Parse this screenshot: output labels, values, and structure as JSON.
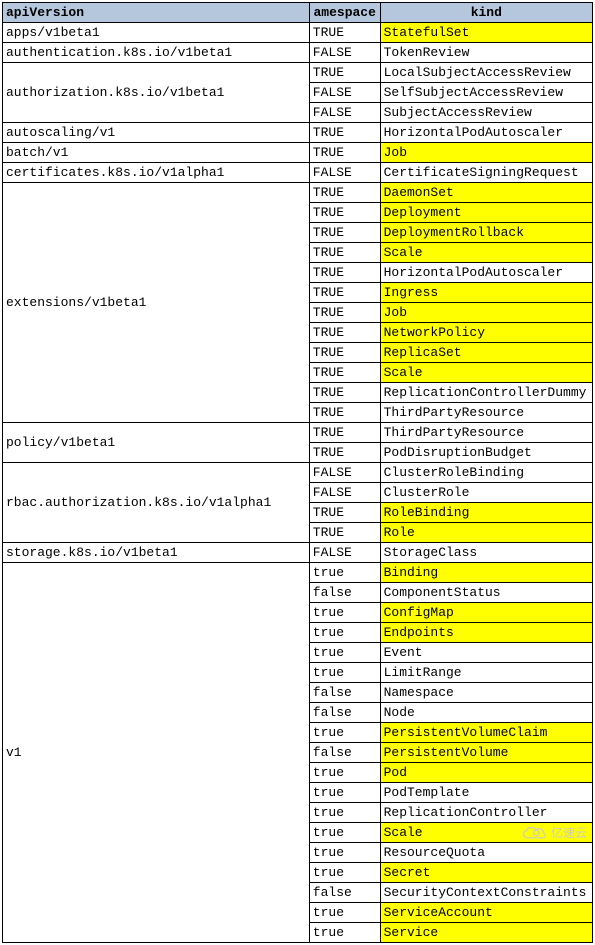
{
  "headers": {
    "c1": "apiVersion",
    "c2": "amespace",
    "c3": "kind"
  },
  "groups": [
    {
      "api": "apps/v1beta1",
      "rows": [
        {
          "ns": "TRUE",
          "kind": "StatefulSet",
          "hl": true
        }
      ]
    },
    {
      "api": "authentication.k8s.io/v1beta1",
      "rows": [
        {
          "ns": "FALSE",
          "kind": "TokenReview",
          "hl": false
        }
      ]
    },
    {
      "api": "authorization.k8s.io/v1beta1",
      "rows": [
        {
          "ns": "TRUE",
          "kind": "LocalSubjectAccessReview",
          "hl": false
        },
        {
          "ns": "FALSE",
          "kind": "SelfSubjectAccessReview",
          "hl": false
        },
        {
          "ns": "FALSE",
          "kind": "SubjectAccessReview",
          "hl": false
        }
      ]
    },
    {
      "api": "autoscaling/v1",
      "rows": [
        {
          "ns": "TRUE",
          "kind": "HorizontalPodAutoscaler",
          "hl": false
        }
      ]
    },
    {
      "api": "batch/v1",
      "rows": [
        {
          "ns": "TRUE",
          "kind": "Job",
          "hl": true
        }
      ]
    },
    {
      "api": "certificates.k8s.io/v1alpha1",
      "rows": [
        {
          "ns": "FALSE",
          "kind": "CertificateSigningRequest",
          "hl": false
        }
      ]
    },
    {
      "api": "extensions/v1beta1",
      "rows": [
        {
          "ns": "TRUE",
          "kind": "DaemonSet",
          "hl": true
        },
        {
          "ns": "TRUE",
          "kind": "Deployment",
          "hl": true
        },
        {
          "ns": "TRUE",
          "kind": "DeploymentRollback",
          "hl": true
        },
        {
          "ns": "TRUE",
          "kind": "Scale",
          "hl": true
        },
        {
          "ns": "TRUE",
          "kind": "HorizontalPodAutoscaler",
          "hl": false
        },
        {
          "ns": "TRUE",
          "kind": "Ingress",
          "hl": true
        },
        {
          "ns": "TRUE",
          "kind": "Job",
          "hl": true
        },
        {
          "ns": "TRUE",
          "kind": "NetworkPolicy",
          "hl": true
        },
        {
          "ns": "TRUE",
          "kind": "ReplicaSet",
          "hl": true
        },
        {
          "ns": "TRUE",
          "kind": "Scale",
          "hl": true
        },
        {
          "ns": "TRUE",
          "kind": "ReplicationControllerDummy",
          "hl": false
        },
        {
          "ns": "TRUE",
          "kind": "ThirdPartyResource",
          "hl": false
        }
      ]
    },
    {
      "api": "policy/v1beta1",
      "rows": [
        {
          "ns": "TRUE",
          "kind": "ThirdPartyResource",
          "hl": false
        },
        {
          "ns": "TRUE",
          "kind": "PodDisruptionBudget",
          "hl": false
        }
      ]
    },
    {
      "api": "rbac.authorization.k8s.io/v1alpha1",
      "rows": [
        {
          "ns": "FALSE",
          "kind": "ClusterRoleBinding",
          "hl": false
        },
        {
          "ns": "FALSE",
          "kind": "ClusterRole",
          "hl": false
        },
        {
          "ns": "TRUE",
          "kind": "RoleBinding",
          "hl": true
        },
        {
          "ns": "TRUE",
          "kind": "Role",
          "hl": true
        }
      ]
    },
    {
      "api": "storage.k8s.io/v1beta1",
      "rows": [
        {
          "ns": "FALSE",
          "kind": "StorageClass",
          "hl": false
        }
      ]
    },
    {
      "api": "v1",
      "rows": [
        {
          "ns": "true",
          "kind": "Binding",
          "hl": true
        },
        {
          "ns": "false",
          "kind": "ComponentStatus",
          "hl": false
        },
        {
          "ns": "true",
          "kind": "ConfigMap",
          "hl": true
        },
        {
          "ns": "true",
          "kind": "Endpoints",
          "hl": true
        },
        {
          "ns": "true",
          "kind": "Event",
          "hl": false
        },
        {
          "ns": "true",
          "kind": "LimitRange",
          "hl": false
        },
        {
          "ns": "false",
          "kind": "Namespace",
          "hl": false
        },
        {
          "ns": "false",
          "kind": "Node",
          "hl": false
        },
        {
          "ns": "true",
          "kind": "PersistentVolumeClaim",
          "hl": true
        },
        {
          "ns": "false",
          "kind": "PersistentVolume",
          "hl": true
        },
        {
          "ns": "true",
          "kind": "Pod",
          "hl": true
        },
        {
          "ns": "true",
          "kind": "PodTemplate",
          "hl": false
        },
        {
          "ns": "true",
          "kind": "ReplicationController",
          "hl": false
        },
        {
          "ns": "true",
          "kind": "Scale",
          "hl": true
        },
        {
          "ns": "true",
          "kind": "ResourceQuota",
          "hl": false
        },
        {
          "ns": "true",
          "kind": "Secret",
          "hl": true
        },
        {
          "ns": "false",
          "kind": "SecurityContextConstraints",
          "hl": false
        },
        {
          "ns": "true",
          "kind": "ServiceAccount",
          "hl": true
        },
        {
          "ns": "true",
          "kind": "Service",
          "hl": true
        }
      ]
    }
  ],
  "watermark": "亿速云"
}
